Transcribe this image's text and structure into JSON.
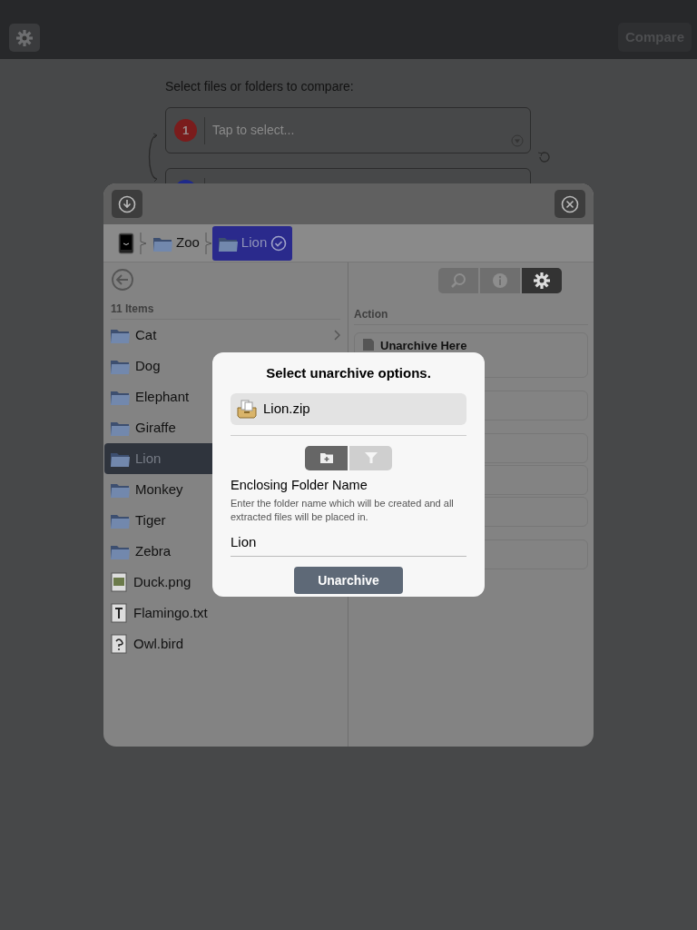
{
  "toolbar": {
    "compare_button": "Compare"
  },
  "compare": {
    "prompt": "Select files or folders to compare:",
    "slots": [
      {
        "number": "1",
        "placeholder": "Tap to select...",
        "color": "#7a1c1c"
      },
      {
        "color": "#1f2a8a"
      }
    ]
  },
  "browser": {
    "breadcrumbs": [
      {
        "kind": "device",
        "selected": false
      },
      {
        "kind": "folder",
        "label": "Zoo",
        "selected": false
      },
      {
        "kind": "folder",
        "label": "Lion",
        "selected": true
      }
    ],
    "list": {
      "count": "11 Items",
      "items": [
        {
          "kind": "folder",
          "name": "Cat",
          "selected": false
        },
        {
          "kind": "folder",
          "name": "Dog",
          "selected": false
        },
        {
          "kind": "folder",
          "name": "Elephant",
          "selected": false
        },
        {
          "kind": "folder",
          "name": "Giraffe",
          "selected": false
        },
        {
          "kind": "folder",
          "name": "Lion",
          "selected": true
        },
        {
          "kind": "folder",
          "name": "Monkey",
          "selected": false
        },
        {
          "kind": "folder",
          "name": "Tiger",
          "selected": false
        },
        {
          "kind": "folder",
          "name": "Zebra",
          "selected": false
        },
        {
          "kind": "image",
          "name": "Duck.png",
          "selected": false
        },
        {
          "kind": "text",
          "name": "Flamingo.txt",
          "selected": false
        },
        {
          "kind": "unknown",
          "name": "Owl.bird",
          "selected": false
        }
      ]
    },
    "inspector": {
      "tabs": [
        {
          "kind": "search",
          "selected": false
        },
        {
          "kind": "info",
          "selected": false
        },
        {
          "kind": "settings",
          "selected": true
        }
      ],
      "section": "Action",
      "actions": [
        {
          "label": "Unarchive Here"
        }
      ]
    }
  },
  "dialog": {
    "title": "Select unarchive options.",
    "file": "Lion.zip",
    "modes": [
      {
        "kind": "new-folder",
        "selected": true
      },
      {
        "kind": "filter",
        "selected": false
      }
    ],
    "field_label": "Enclosing Folder Name",
    "hint": "Enter the folder name which will be created and all extracted files will be placed in.",
    "value": "Lion",
    "button": "Unarchive"
  }
}
